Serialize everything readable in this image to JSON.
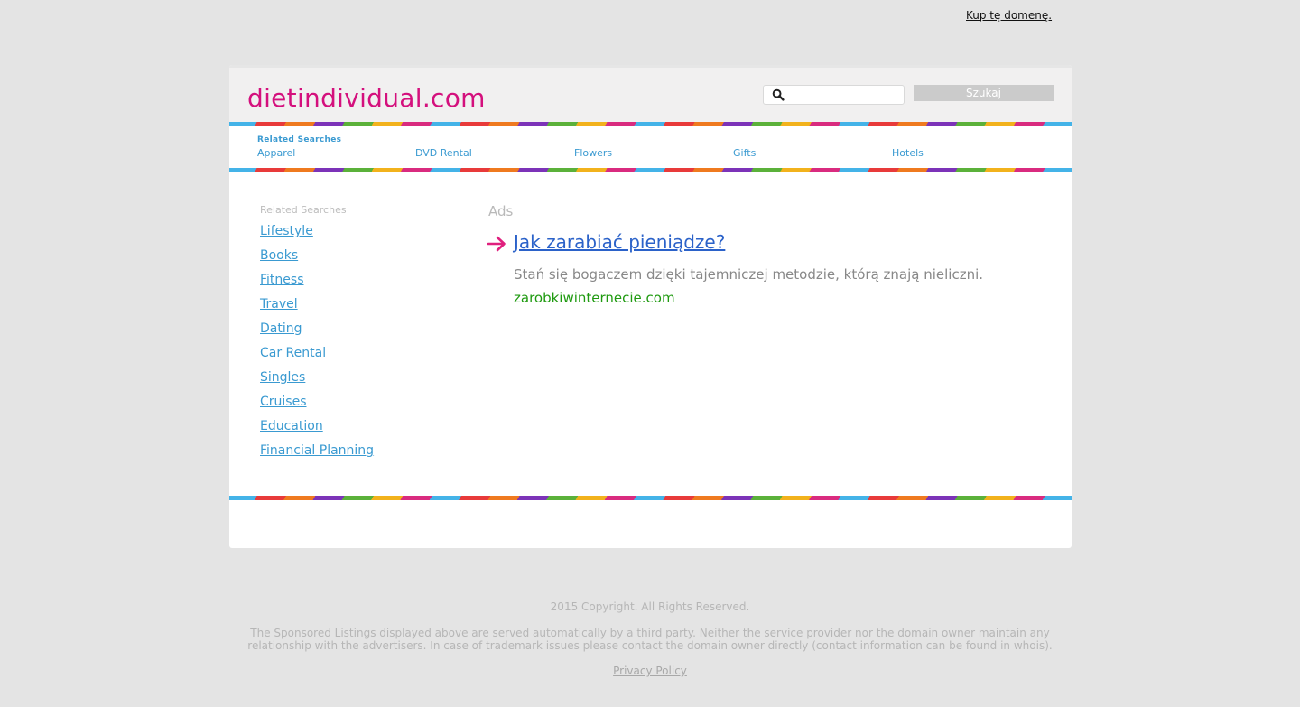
{
  "top_bar": {
    "buy_domain_label": "Kup tę domenę."
  },
  "header": {
    "site_title": "dietindividual.com",
    "search": {
      "placeholder": "",
      "button_label": "Szukaj"
    }
  },
  "top_nav": {
    "heading": "Related Searches",
    "items": [
      {
        "label": "Apparel"
      },
      {
        "label": "DVD Rental"
      },
      {
        "label": "Flowers"
      },
      {
        "label": "Gifts"
      },
      {
        "label": "Hotels"
      }
    ]
  },
  "sidebar": {
    "heading": "Related Searches",
    "items": [
      {
        "label": "Lifestyle"
      },
      {
        "label": "Books"
      },
      {
        "label": "Fitness"
      },
      {
        "label": "Travel"
      },
      {
        "label": "Dating"
      },
      {
        "label": "Car Rental"
      },
      {
        "label": "Singles"
      },
      {
        "label": "Cruises"
      },
      {
        "label": "Education"
      },
      {
        "label": "Financial Planning"
      }
    ]
  },
  "ads": {
    "label": "Ads",
    "items": [
      {
        "title": "Jak zarabiać pieniądze?",
        "description": "Stań się bogaczem dzięki tajemniczej metodzie, którą znają nieliczni.",
        "domain": "zarobkiwinternecie.com"
      }
    ]
  },
  "footer": {
    "copyright": "2015 Copyright. All Rights Reserved.",
    "disclaimer": "The Sponsored Listings displayed above are served automatically by a third party. Neither the service provider nor the domain owner maintain any relationship with the advertisers. In case of trademark issues please contact the domain owner directly (contact information can be found in whois).",
    "privacy_label": "Privacy Policy"
  },
  "colors": {
    "page_background": "#e4e4e4",
    "brand": "#d4107d",
    "link": "#3a9ad1",
    "ad_title": "#2b62c9",
    "ad_domain": "#1f9a10",
    "arrow": "#e0207e"
  },
  "icons": {
    "search": "search-icon",
    "ad_arrow": "arrow-right-icon"
  }
}
